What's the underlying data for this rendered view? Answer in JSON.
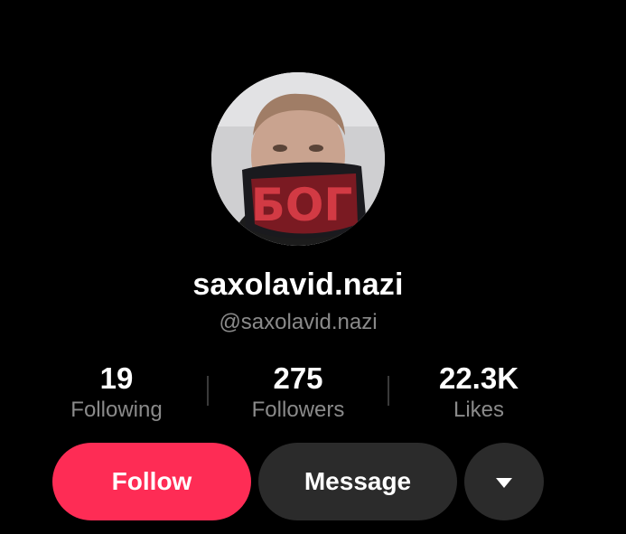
{
  "profile": {
    "display_name": "saxolavid.nazi",
    "handle": "@saxolavid.nazi",
    "avatar_icon": "profile-photo",
    "mask_lettering": "БОГ"
  },
  "stats": {
    "following": {
      "value": "19",
      "label": "Following"
    },
    "followers": {
      "value": "275",
      "label": "Followers"
    },
    "likes": {
      "value": "22.3K",
      "label": "Likes"
    }
  },
  "actions": {
    "follow_label": "Follow",
    "message_label": "Message",
    "more_icon": "caret-down-icon"
  },
  "colors": {
    "background": "#000000",
    "follow_button": "#fe2c55",
    "secondary_button": "#2b2b2b",
    "muted_text": "#8a8a8a"
  }
}
